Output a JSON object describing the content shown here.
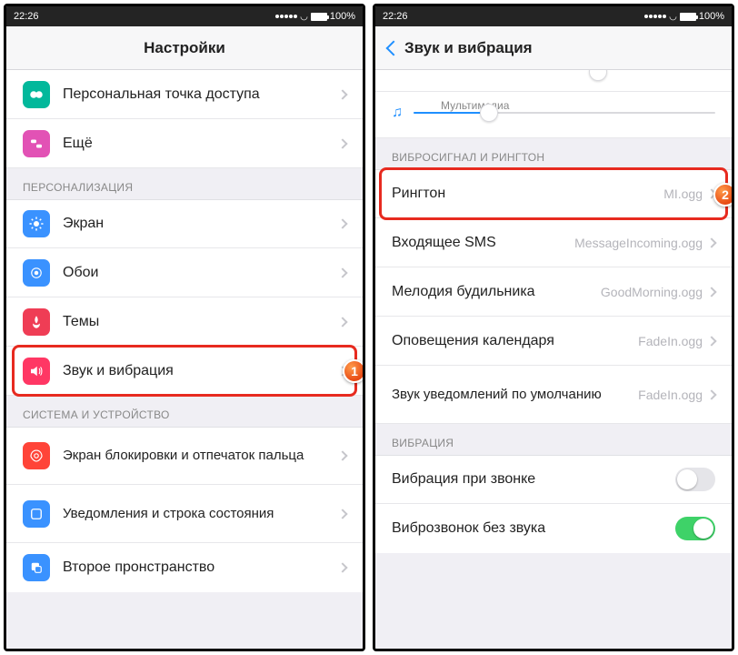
{
  "status": {
    "time": "22:26",
    "battery": "100%"
  },
  "left": {
    "title": "Настройки",
    "section_top_rows": [
      {
        "label": "Персональная точка доступа",
        "icon": "hotspot"
      },
      {
        "label": "Ещё",
        "icon": "more"
      }
    ],
    "section_personal_header": "ПЕРСОНАЛИЗАЦИЯ",
    "section_personal_rows": [
      {
        "label": "Экран",
        "icon": "display"
      },
      {
        "label": "Обои",
        "icon": "wallpaper"
      },
      {
        "label": "Темы",
        "icon": "themes"
      },
      {
        "label": "Звук и вибрация",
        "icon": "sound"
      }
    ],
    "section_system_header": "СИСТЕМА И УСТРОЙСТВО",
    "section_system_rows": [
      {
        "label": "Экран блокировки и отпечаток пальца",
        "icon": "lockscreen"
      },
      {
        "label": "Уведомления и строка состояния",
        "icon": "notifications"
      },
      {
        "label": "Второе пронстранство",
        "icon": "second-space"
      }
    ],
    "badge_highlight": "1"
  },
  "right": {
    "title": "Звук и вибрация",
    "slider_label": "Мультимедиа",
    "slider_fill_pct": 25,
    "section_vibro_header": "ВИБРОСИГНАЛ И РИНГТОН",
    "ringtone_rows": [
      {
        "label": "Рингтон",
        "value": "MI.ogg"
      },
      {
        "label": "Входящее SMS",
        "value": "MessageIncoming.ogg"
      },
      {
        "label": "Мелодия будильника",
        "value": "GoodMorning.ogg"
      },
      {
        "label": "Оповещения календаря",
        "value": "FadeIn.ogg"
      },
      {
        "label": "Звук уведомлений по умолчанию",
        "value": "FadeIn.ogg"
      }
    ],
    "section_vibration_header": "ВИБРАЦИЯ",
    "vibration_rows": [
      {
        "label": "Вибрация при звонке",
        "on": false
      },
      {
        "label": "Виброзвонок без звука",
        "on": true
      }
    ],
    "badge_highlight": "2"
  }
}
